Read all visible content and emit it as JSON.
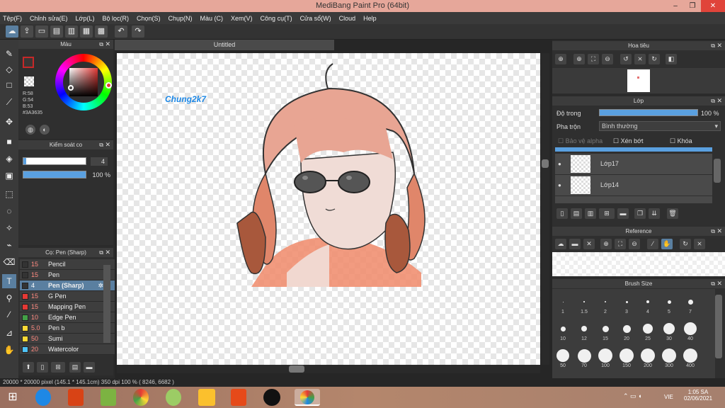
{
  "app": {
    "title": "MediBang Paint Pro (64bit)",
    "window_controls": [
      "–",
      "❐",
      "✕"
    ]
  },
  "menu": [
    "Tệp(F)",
    "Chỉnh sửa(E)",
    "Lớp(L)",
    "Bộ lọc(R)",
    "Chọn(S)",
    "Chụp(N)",
    "Màu (C)",
    "Xem(V)",
    "Công cụ(T)",
    "Cửa sổ(W)",
    "Cloud",
    "Help"
  ],
  "color_panel": {
    "title": "Màu",
    "r": "R:58",
    "g": "G:54",
    "b": "B:53",
    "hex": "#3A3635",
    "fg": "#3A3635"
  },
  "brush_control": {
    "title": "Kiểm soát co",
    "size": "4",
    "opacity": "100 %"
  },
  "brush_list": {
    "title": "Cọ: Pen (Sharp)",
    "items": [
      {
        "size": "15",
        "name": "Pencil",
        "color": "#333333"
      },
      {
        "size": "15",
        "name": "Pen",
        "color": "#333333"
      },
      {
        "size": "4",
        "name": "Pen (Sharp)",
        "color": "#333333"
      },
      {
        "size": "15",
        "name": "G Pen",
        "color": "#e53935"
      },
      {
        "size": "15",
        "name": "Mapping Pen",
        "color": "#e53935"
      },
      {
        "size": "10",
        "name": "Edge Pen",
        "color": "#43a047"
      },
      {
        "size": "5.0",
        "name": "Pen b",
        "color": "#fdd835"
      },
      {
        "size": "50",
        "name": "Sumi",
        "color": "#fdd835"
      },
      {
        "size": "20",
        "name": "Watercolor",
        "color": "#4fc3f7"
      }
    ]
  },
  "canvas": {
    "tab": "Untitled",
    "signature": "Chung2k7"
  },
  "navigator": {
    "title": "Hoa tiêu"
  },
  "layers": {
    "title": "Lớp",
    "opacity_label": "Độ trong",
    "opacity_value": "100 %",
    "blend_label": "Pha trộn",
    "blend_value": "Bình thường",
    "protect_alpha": "Bảo vệ alpha",
    "clipping": "Xén bớt",
    "lock": "Khóa",
    "items": [
      "Lớp17",
      "Lớp14"
    ]
  },
  "reference": {
    "title": "Reference"
  },
  "brush_size": {
    "title": "Brush Size",
    "sizes": [
      "1",
      "1.5",
      "2",
      "3",
      "4",
      "5",
      "7",
      "10",
      "12",
      "15",
      "20",
      "25",
      "30",
      "40",
      "50",
      "70",
      "100",
      "150",
      "200",
      "300",
      "400"
    ]
  },
  "status": {
    "text": "20000 * 20000 pixel   (145.1 * 145.1cm)   350 dpi   100 %   ( 8246, 6682 )"
  },
  "taskbar": {
    "lang": "VIE",
    "time": "1:05 SA",
    "date": "02/06/2021"
  }
}
